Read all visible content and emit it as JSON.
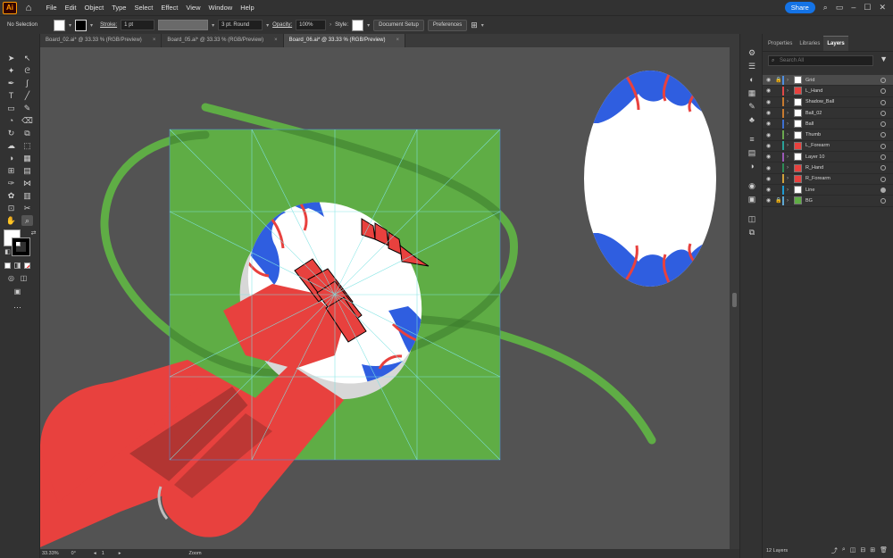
{
  "menubar": {
    "logo": "Ai",
    "items": [
      "File",
      "Edit",
      "Object",
      "Type",
      "Select",
      "Effect",
      "View",
      "Window",
      "Help"
    ],
    "share_label": "Share"
  },
  "controlbar": {
    "selection": "No Selection",
    "stroke_label": "Stroke:",
    "stroke_value": "1 pt",
    "brush_value": "3 pt. Round",
    "opacity_label": "Opacity:",
    "opacity_value": "100%",
    "style_label": "Style:",
    "doc_setup": "Document Setup",
    "preferences": "Preferences"
  },
  "tabs": [
    {
      "label": "Board_02.ai* @ 33.33 % (RGB/Preview)",
      "active": false
    },
    {
      "label": "Board_05.ai* @ 33.33 % (RGB/Preview)",
      "active": false
    },
    {
      "label": "Board_06.ai* @ 33.33 % (RGB/Preview)",
      "active": true
    }
  ],
  "statusbar": {
    "zoom": "33.33%",
    "rotation": "0°",
    "artboard": "1",
    "mode": "Zoom"
  },
  "panel": {
    "tabs": [
      "Properties",
      "Libraries",
      "Layers"
    ],
    "active_tab": "Layers",
    "search_placeholder": "Search All",
    "layers": [
      {
        "name": "Grid",
        "color": "#4f8fe0",
        "locked": true,
        "selected": true
      },
      {
        "name": "L_Hand",
        "color": "#e04848",
        "locked": false,
        "selected": false
      },
      {
        "name": "Shadow_Ball",
        "color": "#c77a2f",
        "locked": false,
        "selected": false
      },
      {
        "name": "Ball_02",
        "color": "#c77a2f",
        "locked": false,
        "selected": false
      },
      {
        "name": "Ball",
        "color": "#3d6fd1",
        "locked": false,
        "selected": false
      },
      {
        "name": "Thumb",
        "color": "#6aa84f",
        "locked": false,
        "selected": false
      },
      {
        "name": "L_Forearm",
        "color": "#2aa198",
        "locked": false,
        "selected": false
      },
      {
        "name": "Layer 10",
        "color": "#9b59b6",
        "locked": false,
        "selected": false
      },
      {
        "name": "R_Hand",
        "color": "#2e8b57",
        "locked": false,
        "selected": false
      },
      {
        "name": "R_Forearm",
        "color": "#d1a13d",
        "locked": false,
        "selected": false
      },
      {
        "name": "Line",
        "color": "#1f9bd1",
        "locked": false,
        "selected": false
      },
      {
        "name": "BG",
        "color": "#5fa8d3",
        "locked": true,
        "selected": false
      }
    ],
    "layer_count": "12 Layers"
  },
  "colors": {
    "green": "#5fad45",
    "red": "#e8413e",
    "blue": "#2f5ee0",
    "chrome": "#323232",
    "canvas": "#535353"
  }
}
